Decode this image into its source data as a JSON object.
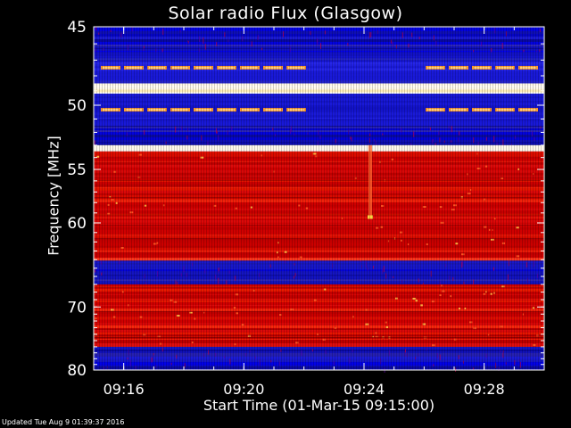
{
  "chart_data": {
    "type": "heatmap",
    "title": "Solar radio Flux (Glasgow)",
    "xlabel": "Start Time (01-Mar-15 09:15:00)",
    "ylabel": "Frequency [MHz]",
    "x_ticks": [
      "09:16",
      "09:20",
      "09:24",
      "09:28"
    ],
    "x_tick_values": [
      "09:16",
      "09:20",
      "09:24",
      "09:28"
    ],
    "y_ticks": [
      45,
      50,
      55,
      60,
      70,
      80
    ],
    "ylim": [
      45,
      80
    ],
    "xlim": [
      "09:15:00",
      "09:30:00"
    ],
    "colormap": "blue-red-yellow-white",
    "bands": [
      {
        "from": 45,
        "to": 46.5,
        "level": "low"
      },
      {
        "from": 46.5,
        "to": 48.5,
        "level": "medium-with-bursts"
      },
      {
        "from": 48.5,
        "to": 49.2,
        "level": "saturated"
      },
      {
        "from": 49.2,
        "to": 51.5,
        "level": "medium-with-bursts"
      },
      {
        "from": 51.5,
        "to": 53,
        "level": "low"
      },
      {
        "from": 53,
        "to": 53.5,
        "level": "saturated"
      },
      {
        "from": 53.5,
        "to": 64,
        "level": "high"
      },
      {
        "from": 64,
        "to": 67,
        "level": "low"
      },
      {
        "from": 67,
        "to": 76,
        "level": "high"
      },
      {
        "from": 76,
        "to": 80,
        "level": "low"
      }
    ],
    "features": [
      {
        "time": "09:24",
        "freq_from": 53,
        "freq_to": 59.5,
        "type": "vertical burst"
      }
    ]
  },
  "updated": "Updated Tue Aug  9 01:39:37 2016",
  "colors": {
    "background": "#000000",
    "axis": "#ffffff"
  }
}
